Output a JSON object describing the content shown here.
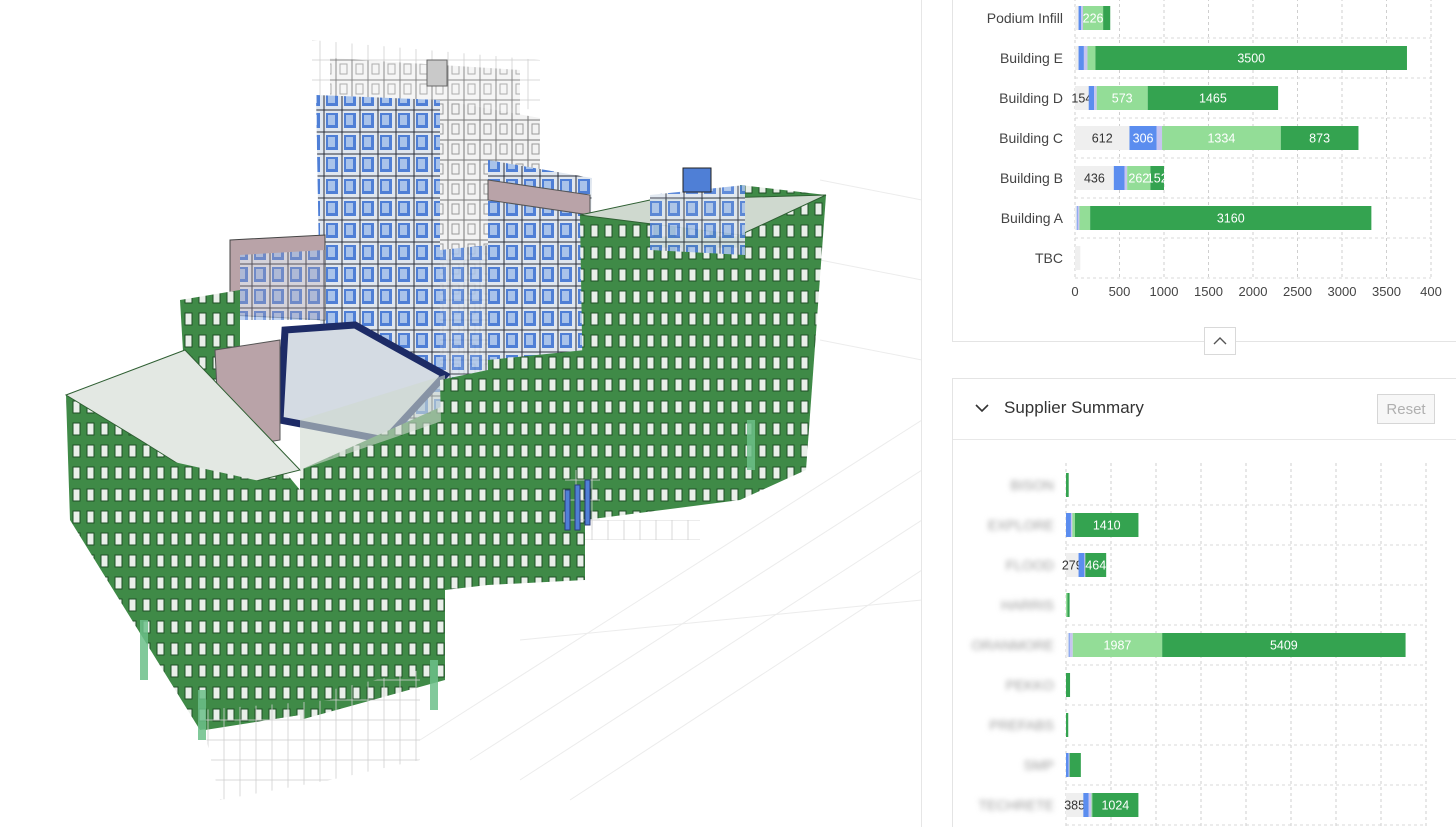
{
  "colors": {
    "building_green": "#2f7d3a",
    "glass_blue": "#4f7fd6",
    "muted_mauve": "#b9a3a8",
    "seg_unassigned": "#efefef",
    "seg_blue": "#5b8def",
    "seg_lilac": "#c7c4f0",
    "seg_lightgreen": "#93dd97",
    "seg_green": "#34a350"
  },
  "building_chart": {
    "type": "bar",
    "orientation": "horizontal-stacked",
    "categories": [
      "Podium Infill",
      "Building E",
      "Building D",
      "Building C",
      "Building B",
      "Building A",
      "TBC"
    ],
    "series_colors": [
      "#efefef",
      "#5b8def",
      "#c7c4f0",
      "#93dd97",
      "#34a350"
    ],
    "values": [
      [
        40,
        30,
        20,
        226,
        80
      ],
      [
        40,
        60,
        40,
        90,
        3500
      ],
      [
        154,
        60,
        30,
        573,
        1465
      ],
      [
        612,
        306,
        60,
        1334,
        873
      ],
      [
        436,
        120,
        30,
        262,
        152
      ],
      [
        20,
        10,
        20,
        120,
        3160
      ],
      [
        60,
        0,
        0,
        0,
        0
      ]
    ],
    "labels": [
      [
        "",
        "",
        "",
        "226",
        ""
      ],
      [
        "",
        "",
        "",
        "",
        "3500"
      ],
      [
        "154",
        "",
        "",
        "573",
        "1465"
      ],
      [
        "612",
        "306",
        "",
        "1334",
        "873"
      ],
      [
        "436",
        "",
        "",
        "262",
        "152"
      ],
      [
        "",
        "",
        "",
        "",
        "3160"
      ],
      [
        "",
        "",
        "",
        "",
        ""
      ]
    ],
    "x_ticks": [
      "0",
      "500",
      "1000",
      "1500",
      "2000",
      "2500",
      "3000",
      "3500",
      "400"
    ],
    "xlim": [
      0,
      4000
    ]
  },
  "supplier_panel": {
    "title": "Supplier Summary",
    "reset_label": "Reset"
  },
  "supplier_chart": {
    "type": "bar",
    "orientation": "horizontal-stacked",
    "categories": [
      "BISON",
      "EXPLORE",
      "FLOOD",
      "HARRIS",
      "ORANMORE",
      "PEKKO",
      "PREFABS",
      "SMP",
      "TECHRETE"
    ],
    "series_colors": [
      "#efefef",
      "#5b8def",
      "#c7c4f0",
      "#93dd97",
      "#34a350"
    ],
    "values": [
      [
        0,
        0,
        0,
        0,
        60
      ],
      [
        0,
        110,
        30,
        60,
        1410
      ],
      [
        279,
        130,
        20,
        0,
        464
      ],
      [
        0,
        0,
        0,
        30,
        50
      ],
      [
        60,
        20,
        70,
        1987,
        5409
      ],
      [
        0,
        0,
        0,
        0,
        90
      ],
      [
        0,
        0,
        0,
        0,
        50
      ],
      [
        0,
        60,
        20,
        0,
        250
      ],
      [
        385,
        120,
        60,
        20,
        1024
      ]
    ],
    "labels": [
      [
        "",
        "",
        "",
        "",
        ""
      ],
      [
        "",
        "",
        "",
        "",
        "1410"
      ],
      [
        "279",
        "",
        "",
        "",
        "464"
      ],
      [
        "",
        "",
        "",
        "",
        ""
      ],
      [
        "",
        "",
        "",
        "1987",
        "5409"
      ],
      [
        "",
        "",
        "",
        "",
        ""
      ],
      [
        "",
        "",
        "",
        "",
        ""
      ],
      [
        "",
        "",
        "",
        "",
        ""
      ],
      [
        "385",
        "",
        "",
        "",
        "1024"
      ]
    ],
    "xlim": [
      0,
      8000
    ]
  }
}
